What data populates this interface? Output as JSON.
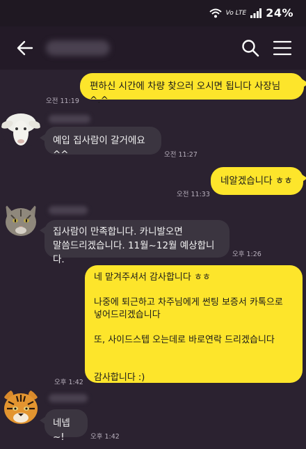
{
  "status_bar": {
    "wifi_icon": "wifi-icon",
    "network_label": "Vo LTE",
    "signal_icon": "signal-icon",
    "battery": "24%"
  },
  "app_bar": {
    "back_icon": "arrow-left-icon",
    "search_icon": "search-icon",
    "menu_icon": "hamburger-menu-icon"
  },
  "messages": [
    {
      "from": "me",
      "text": "편하신 시간에 차량 찾으러 오시면 됩니다 사장님 ^.^",
      "time": "오전 11:19"
    },
    {
      "from": "them",
      "avatar": "sheep",
      "text": "예입 집사람이 갈거에요^^",
      "time": "오전 11:27"
    },
    {
      "from": "me",
      "text": "네알겠습니다 ㅎㅎ",
      "time": "오전 11:33"
    },
    {
      "from": "them",
      "avatar": "cat",
      "text": "집사람이 만족합니다. 카니발오면\n말씀드리겠습니다. 11월~12월 예상합니다.",
      "time": "오후 1:26"
    },
    {
      "from": "me",
      "text": "네 맡겨주셔서 감사합니다 ㅎㅎ\n\n나중에 퇴근하고 차주님에게 썬팅 보증서 카톡으로\n넣어드리겠습니다\n\n또, 사이드스텝 오는데로 바로연락 드리겠습니다\n\n\n감사합니다 :)",
      "time": "오후 1:42"
    },
    {
      "from": "them",
      "avatar": "tiger",
      "text": "네넵~!",
      "time": "오후 1:42"
    }
  ],
  "colors": {
    "background": "#2b2230",
    "my_bubble": "#fde52b",
    "their_bubble": "#3b3540"
  }
}
